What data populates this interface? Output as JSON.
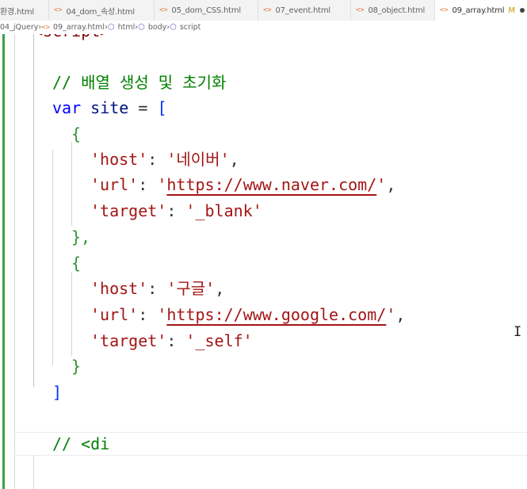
{
  "tabs": [
    {
      "label": "환경.html",
      "active": false
    },
    {
      "label": "04_dom_속성.html",
      "active": false
    },
    {
      "label": "05_dom_CSS.html",
      "active": false
    },
    {
      "label": "07_event.html",
      "active": false
    },
    {
      "label": "08_object.html",
      "active": false
    },
    {
      "label": "09_array.html",
      "active": true,
      "status": "M"
    }
  ],
  "breadcrumb": {
    "folder": "04_jQuery",
    "file": "09_array.html",
    "node1": "html",
    "node2": "body",
    "node3": "script"
  },
  "code": {
    "top_partial": "<script>",
    "comment1": "// 배열 생성 및 초기화",
    "l_var": "var",
    "l_site": "site",
    "l_eq": "=",
    "l_bracket_open": "[",
    "brace_open": "{",
    "brace_close_comma": "},",
    "brace_close": "}",
    "bracket_close": "]",
    "key_host": "'host'",
    "key_url": "'url'",
    "key_target": "'target'",
    "colon": ":",
    "comma": ",",
    "val_host1": "'네이버'",
    "val_url1_q": "'",
    "val_url1_link": "https://www.naver.com/",
    "val_target1": "'_blank'",
    "val_host2": "'구글'",
    "val_url2_link": "https://www.google.com/",
    "val_target2": "'_self'",
    "comment2": "// <di"
  },
  "colors": {
    "comment": "#008000",
    "keyword": "#0000ff",
    "string": "#a31515",
    "modified_gutter": "#3fa04a"
  }
}
